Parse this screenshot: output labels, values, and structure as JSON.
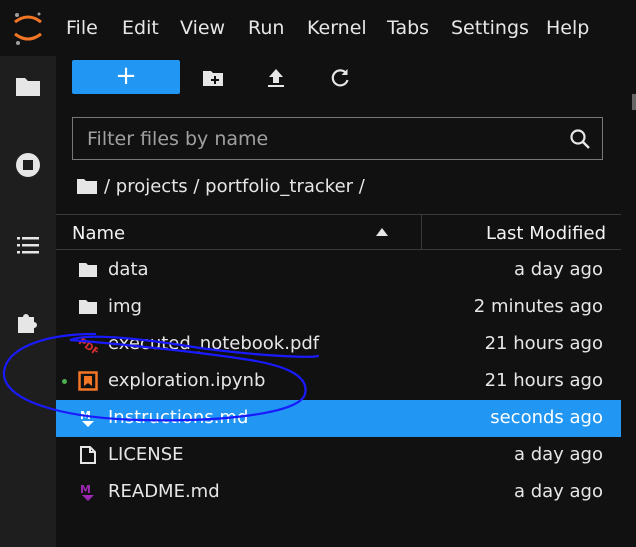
{
  "menubar": {
    "items": [
      "File",
      "Edit",
      "View",
      "Run",
      "Kernel",
      "Tabs",
      "Settings",
      "Help"
    ]
  },
  "activity_bar": {
    "icons": [
      "folder-icon",
      "stop-circle-icon",
      "list-icon",
      "puzzle-icon"
    ]
  },
  "toolbar": {
    "new_label": "+",
    "icons": [
      "new-folder-icon",
      "upload-icon",
      "refresh-icon"
    ]
  },
  "filter": {
    "placeholder": "Filter files by name",
    "value": ""
  },
  "breadcrumb": {
    "text": "/ projects / portfolio_tracker /"
  },
  "table": {
    "headers": {
      "name": "Name",
      "modified": "Last Modified"
    },
    "rows": [
      {
        "name": "data",
        "modified": "a day ago",
        "icon": "folder-icon",
        "selected": false
      },
      {
        "name": "img",
        "modified": "2 minutes ago",
        "icon": "folder-icon",
        "selected": false
      },
      {
        "name": "executed_notebook.pdf",
        "modified": "21 hours ago",
        "icon": "pdf-icon",
        "selected": false
      },
      {
        "name": "exploration.ipynb",
        "modified": "21 hours ago",
        "icon": "notebook-icon",
        "selected": false,
        "running": true
      },
      {
        "name": "Instructions.md",
        "modified": "seconds ago",
        "icon": "markdown-icon",
        "selected": true
      },
      {
        "name": "LICENSE",
        "modified": "a day ago",
        "icon": "file-icon",
        "selected": false
      },
      {
        "name": "README.md",
        "modified": "a day ago",
        "icon": "markdown-icon",
        "selected": false
      }
    ]
  },
  "colors": {
    "accent": "#2196f3",
    "logo": "#f37626",
    "annotation": "#1a1aff",
    "pdf": "#d32f2f",
    "markdown": "#7b1fa2"
  }
}
